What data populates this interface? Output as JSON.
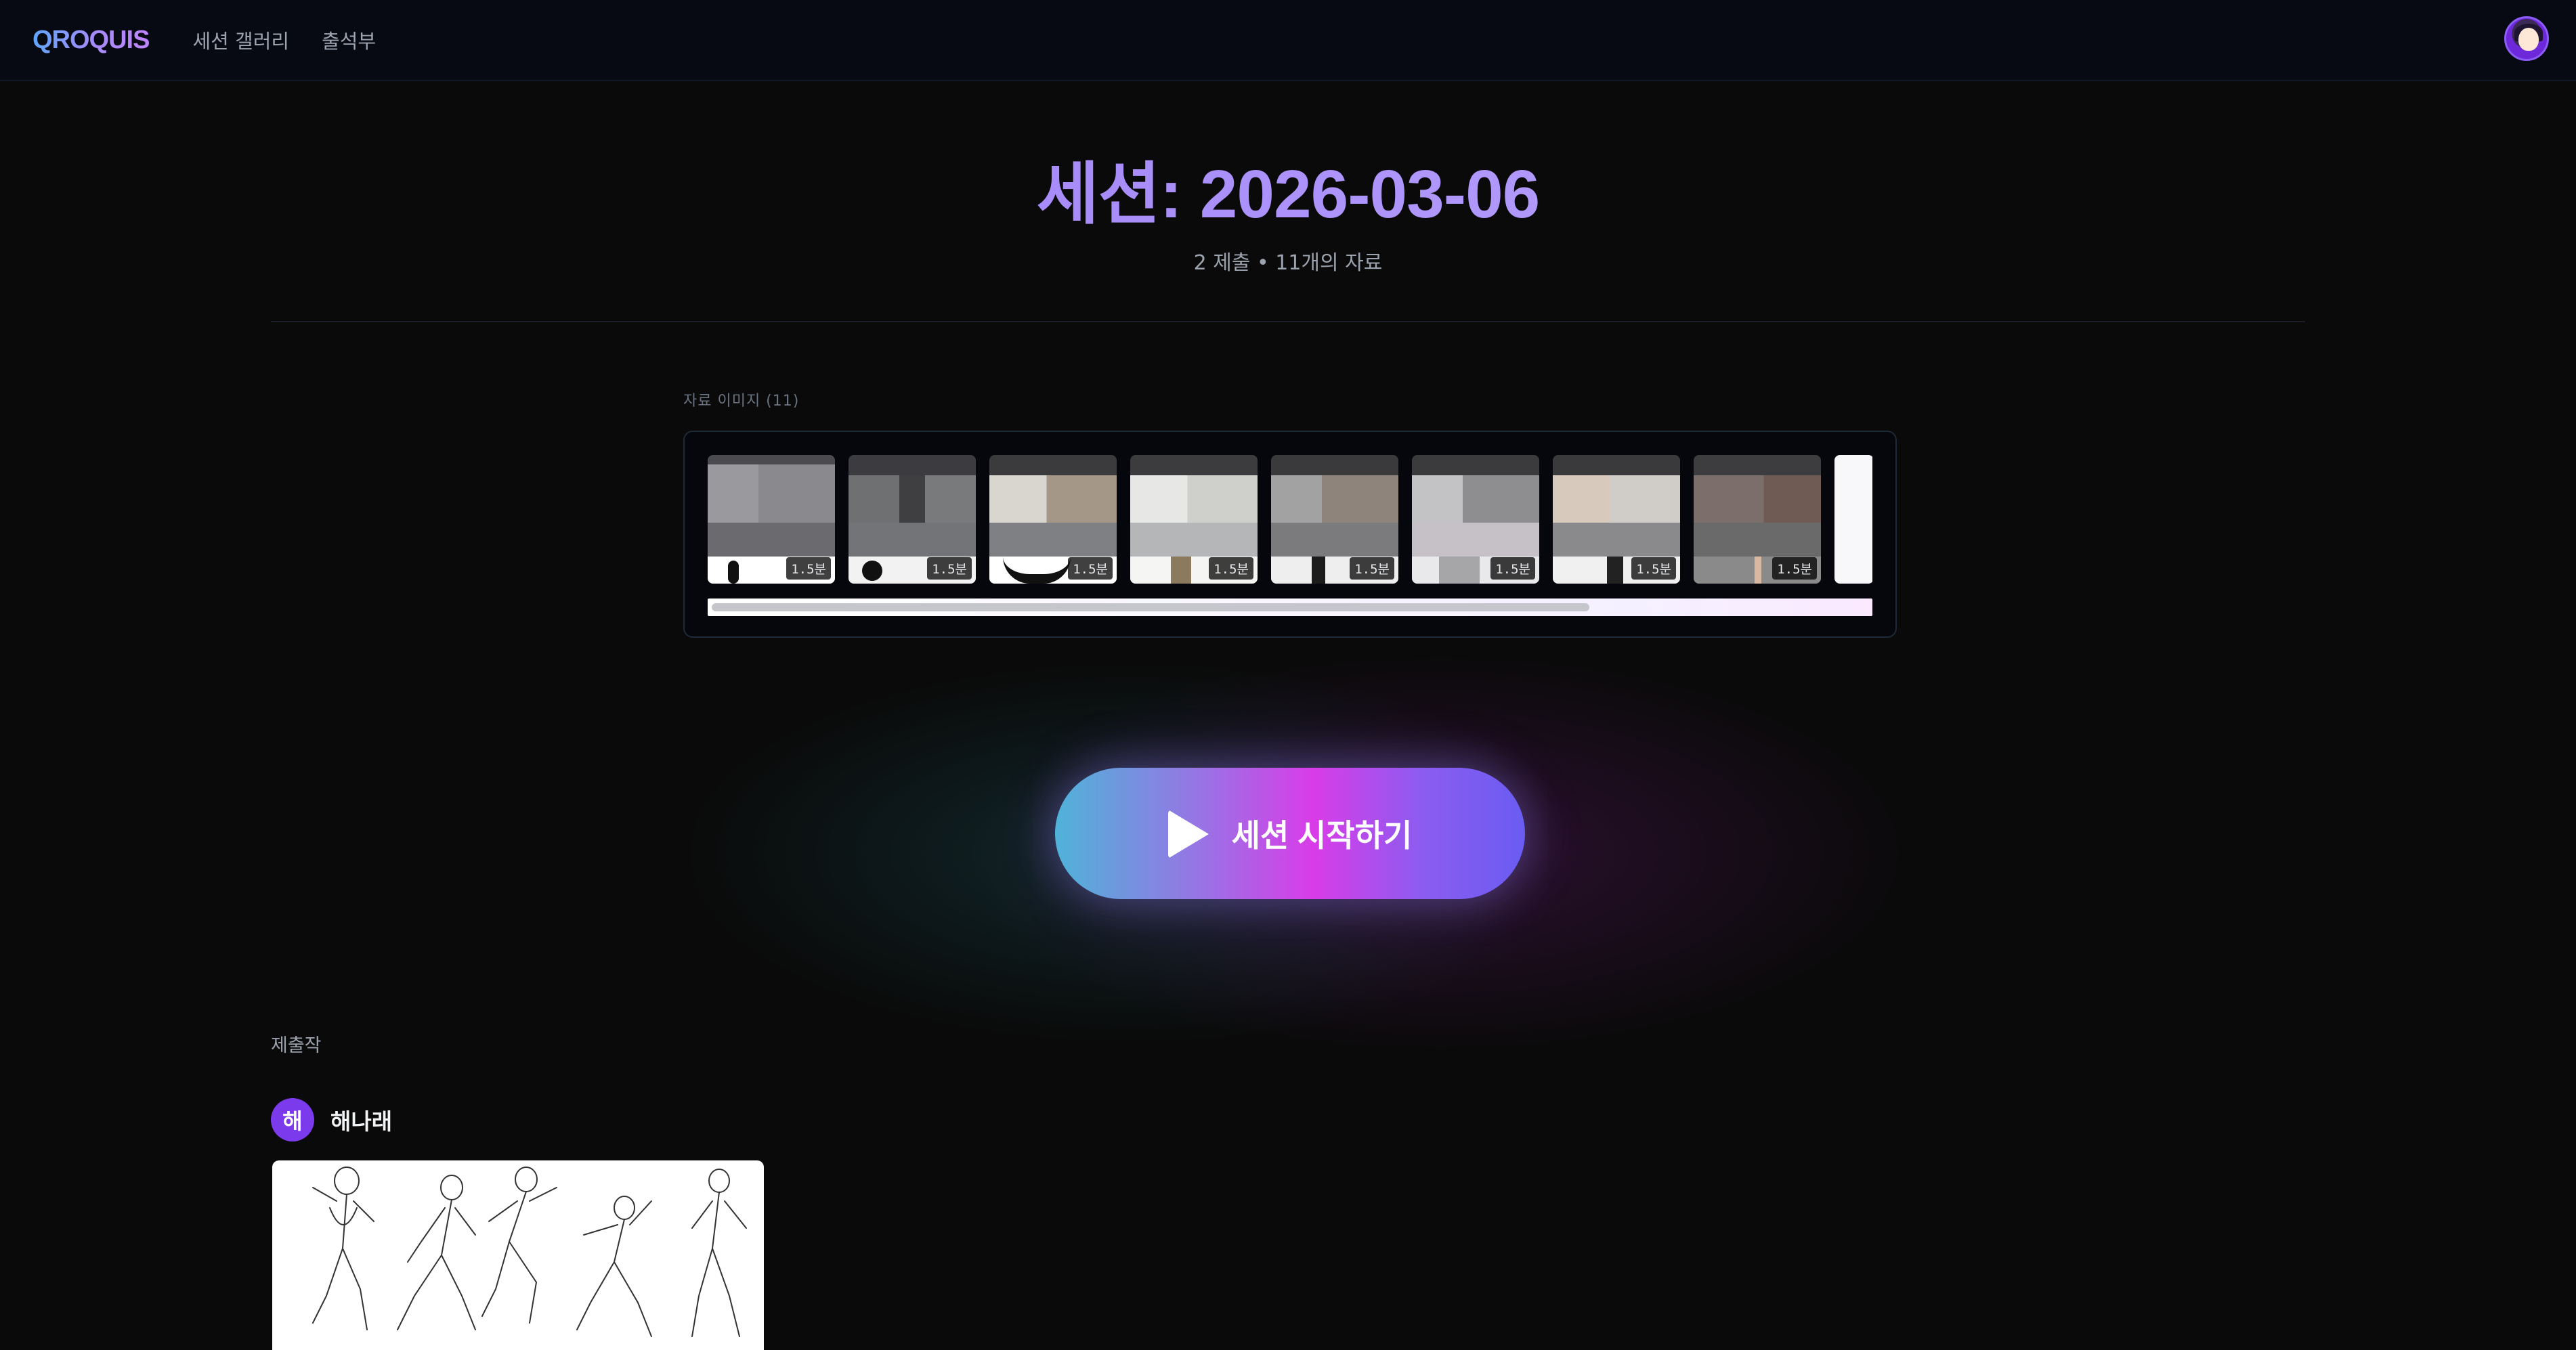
{
  "header": {
    "logo": "QROQUIS",
    "nav": [
      "세션 갤러리",
      "출석부"
    ]
  },
  "session": {
    "title": "세션: 2026-03-06",
    "meta": "2 제출 • 11개의 자료"
  },
  "references": {
    "label": "자료 이미지 (11)",
    "thumbnails": [
      {
        "duration": "1.5분"
      },
      {
        "duration": "1.5분"
      },
      {
        "duration": "1.5분"
      },
      {
        "duration": "1.5분"
      },
      {
        "duration": "1.5분"
      },
      {
        "duration": "1.5분"
      },
      {
        "duration": "1.5분"
      },
      {
        "duration": "1.5분"
      }
    ]
  },
  "start_button": {
    "icon": "play-icon",
    "label": "세션 시작하기"
  },
  "submissions": {
    "label": "제출작",
    "user": {
      "initial": "해",
      "name": "해나래"
    }
  }
}
